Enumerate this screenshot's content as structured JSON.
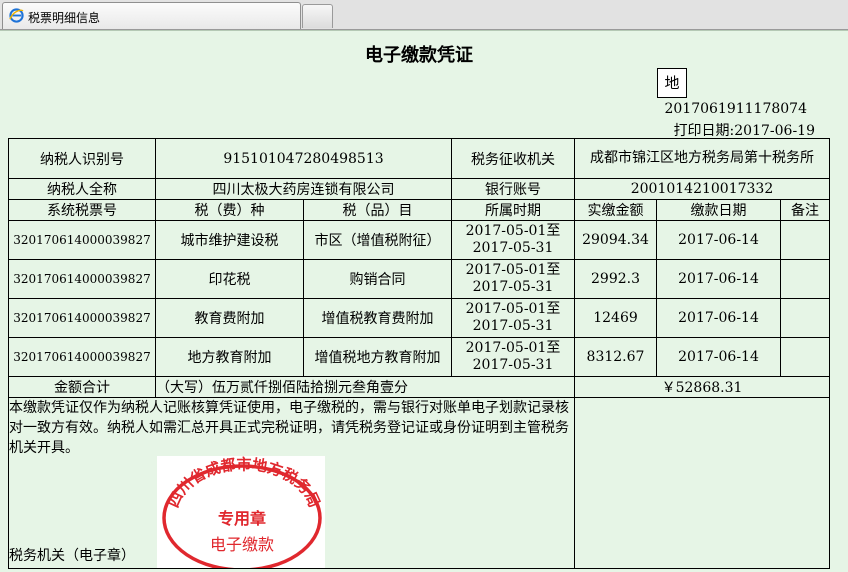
{
  "browser": {
    "tab_title": "税票明细信息"
  },
  "voucher": {
    "title": "电子缴款凭证",
    "region_box": "地",
    "voucher_number": "2017061911178074",
    "print_date": "打印日期:2017-06-19",
    "labels": {
      "taxpayer_id": "纳税人识别号",
      "tax_authority": "税务征收机关",
      "taxpayer_name": "纳税人全称",
      "bank_account": "银行账号",
      "system_ticket_no": "系统税票号",
      "tax_type": "税（费）种",
      "tax_item": "税（品）目",
      "period": "所属时期",
      "amount_paid": "实缴金额",
      "pay_date": "缴款日期",
      "remarks": "备注",
      "total": "金额合计",
      "tax_office_seal": "税务机关（电子章）"
    },
    "taxpayer_id": "915101047280498513",
    "tax_authority": "成都市锦江区地方税务局第十税务所",
    "taxpayer_name": "四川太极大药房连锁有限公司",
    "bank_account": "2001014210017332",
    "rows": [
      {
        "ticket": "320170614000039827",
        "tax_type": "城市维护建设税",
        "tax_item": "市区（增值税附征）",
        "period": "2017-05-01至2017-05-31",
        "amount": "29094.34",
        "date": "2017-06-14",
        "remark": ""
      },
      {
        "ticket": "320170614000039827",
        "tax_type": "印花税",
        "tax_item": "购销合同",
        "period": "2017-05-01至2017-05-31",
        "amount": "2992.3",
        "date": "2017-06-14",
        "remark": ""
      },
      {
        "ticket": "320170614000039827",
        "tax_type": "教育费附加",
        "tax_item": "增值税教育费附加",
        "period": "2017-05-01至2017-05-31",
        "amount": "12469",
        "date": "2017-06-14",
        "remark": ""
      },
      {
        "ticket": "320170614000039827",
        "tax_type": "地方教育附加",
        "tax_item": "增值税地方教育附加",
        "period": "2017-05-01至2017-05-31",
        "amount": "8312.67",
        "date": "2017-06-14",
        "remark": ""
      }
    ],
    "total_words": "（大写）伍万贰仟捌佰陆拾捌元叁角壹分",
    "total_amount": "￥52868.31",
    "note": "本缴款凭证仅作为纳税人记账核算凭证使用，电子缴税的，需与银行对账单电子划款记录核对一致方有效。纳税人如需汇总开具正式完税证明，请凭税务登记证或身份证明到主管税务机关开具。",
    "stamp": {
      "ring_text": "四川省成都市地方税务局",
      "center_text": "专用章",
      "bottom_text": "电子缴款",
      "color": "#e0282e"
    }
  }
}
